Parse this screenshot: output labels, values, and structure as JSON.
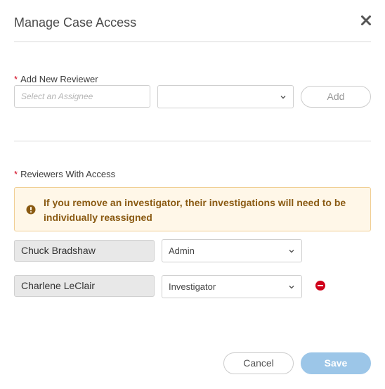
{
  "dialog": {
    "title": "Manage Case Access"
  },
  "add_reviewer": {
    "label": "Add New Reviewer",
    "required_mark": "*",
    "assignee_placeholder": "Select an Assignee",
    "role_value": "",
    "add_label": "Add"
  },
  "reviewers": {
    "label": "Reviewers With Access",
    "required_mark": "*",
    "warning": "If you remove an investigator, their investigations will need to be individually reassigned",
    "rows": [
      {
        "name": "Chuck Bradshaw",
        "role": "Admin"
      },
      {
        "name": "Charlene LeClair",
        "role": "Investigator"
      }
    ]
  },
  "footer": {
    "cancel_label": "Cancel",
    "save_label": "Save"
  },
  "icons": {
    "close": "close-icon",
    "warning": "exclamation-circle-icon",
    "remove": "minus-circle-icon",
    "chevron": "chevron-down-icon"
  },
  "colors": {
    "required": "#d0021b",
    "warning_bg": "#fff7e8",
    "warning_border": "#f0cf94",
    "warning_text": "#8a5a12",
    "remove": "#d0021b",
    "primary_disabled": "#9cc6e8"
  }
}
